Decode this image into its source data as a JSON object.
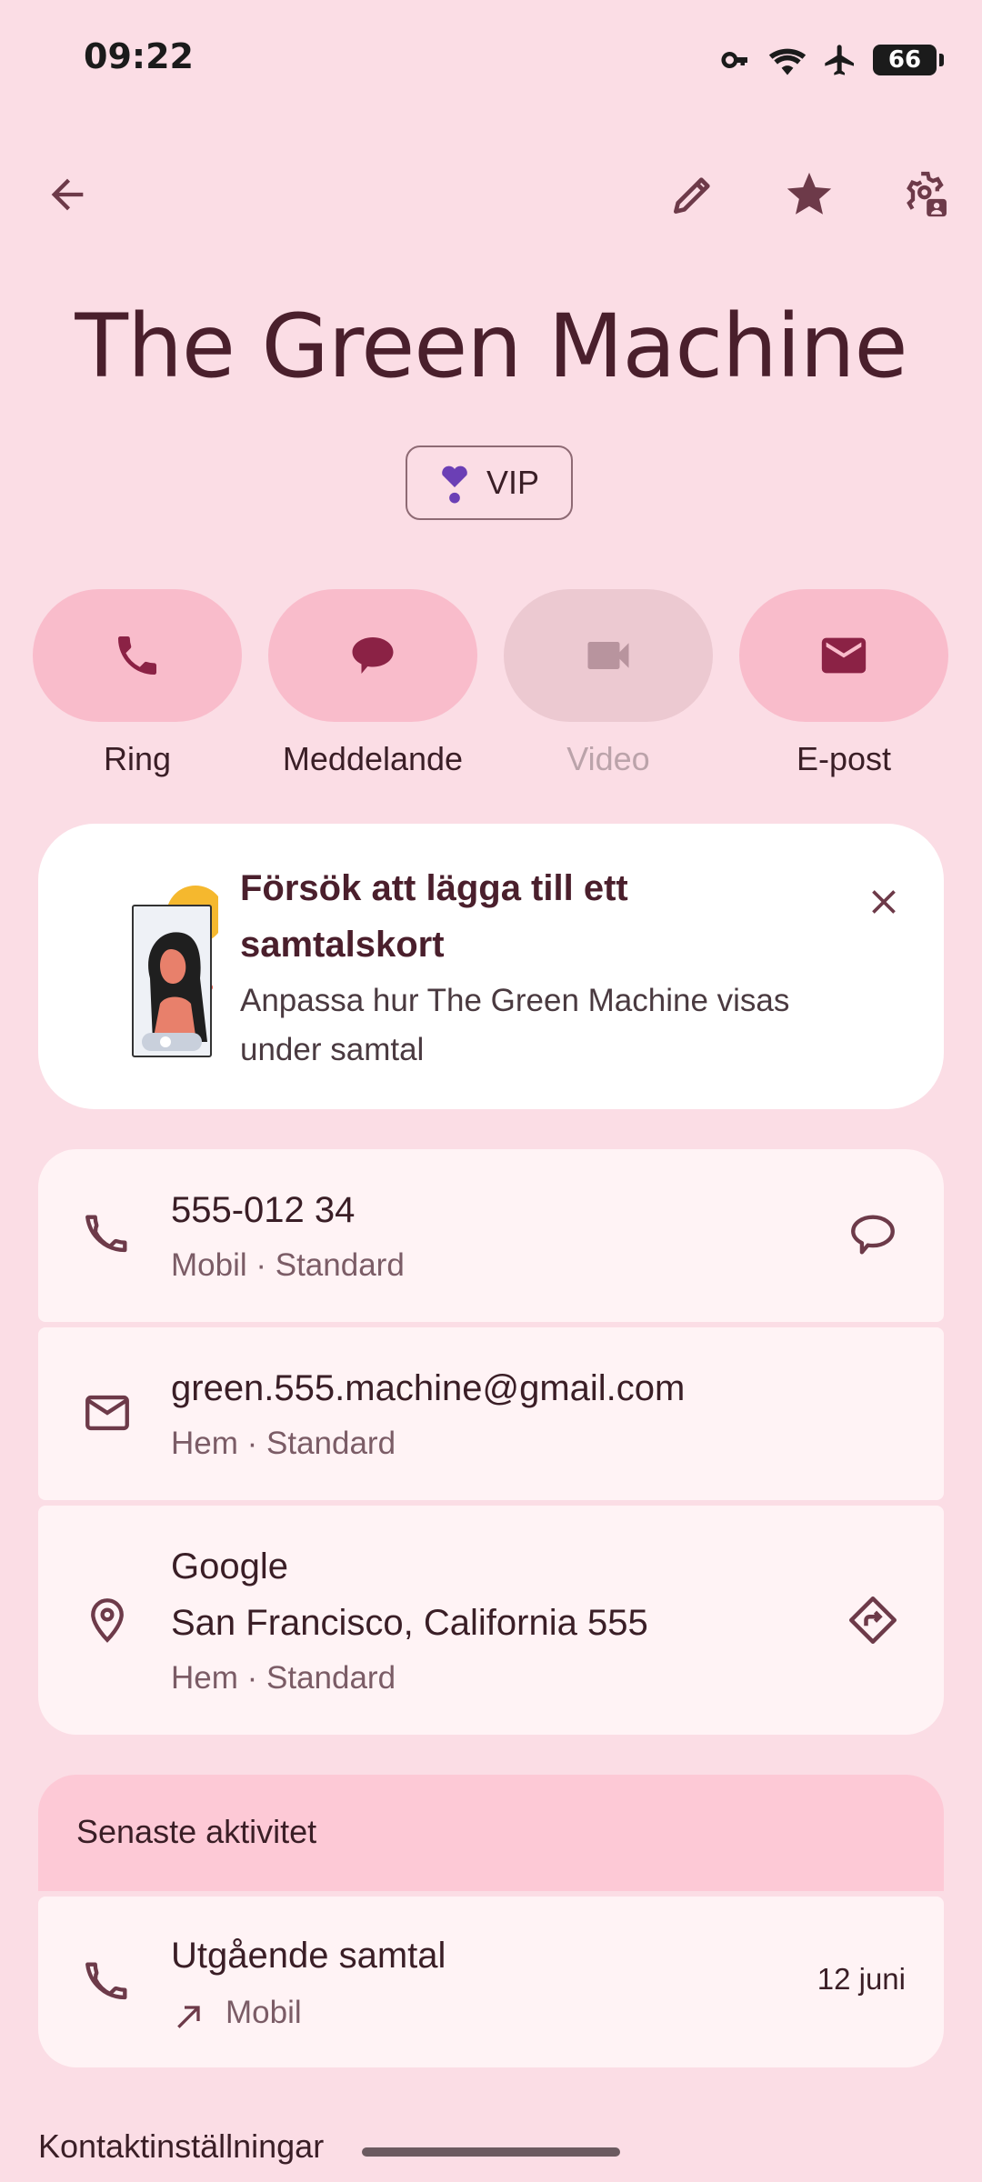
{
  "status_bar": {
    "time": "09:22",
    "battery": "66"
  },
  "header": {
    "contact_name": "The Green Machine"
  },
  "chip": {
    "label": "VIP"
  },
  "actions": [
    {
      "label": "Ring",
      "icon": "phone-icon"
    },
    {
      "label": "Meddelande",
      "icon": "message-icon"
    },
    {
      "label": "Video",
      "icon": "video-icon",
      "disabled": true
    },
    {
      "label": "E-post",
      "icon": "email-icon"
    }
  ],
  "promo": {
    "title": "Försök att lägga till ett samtalskort",
    "subtitle": "Anpassa hur The Green Machine visas under samtal"
  },
  "details": {
    "phone": {
      "number": "555-012 34",
      "meta": "Mobil · Standard"
    },
    "email": {
      "address": "green.555.machine@gmail.com",
      "meta": "Hem · Standard"
    },
    "address": {
      "line1": "Google",
      "line2": "San Francisco, California 555",
      "meta": "Hem · Standard"
    }
  },
  "activity": {
    "heading": "Senaste aktivitet",
    "items": [
      {
        "title": "Utgående samtal",
        "type": "Mobil",
        "date": "12 juni"
      }
    ]
  },
  "footer": {
    "label": "Kontaktinställningar"
  },
  "colors": {
    "background": "#fbdde5",
    "accent": "#8b2245",
    "pill": "#f9bccb",
    "card": "#fff3f5"
  }
}
